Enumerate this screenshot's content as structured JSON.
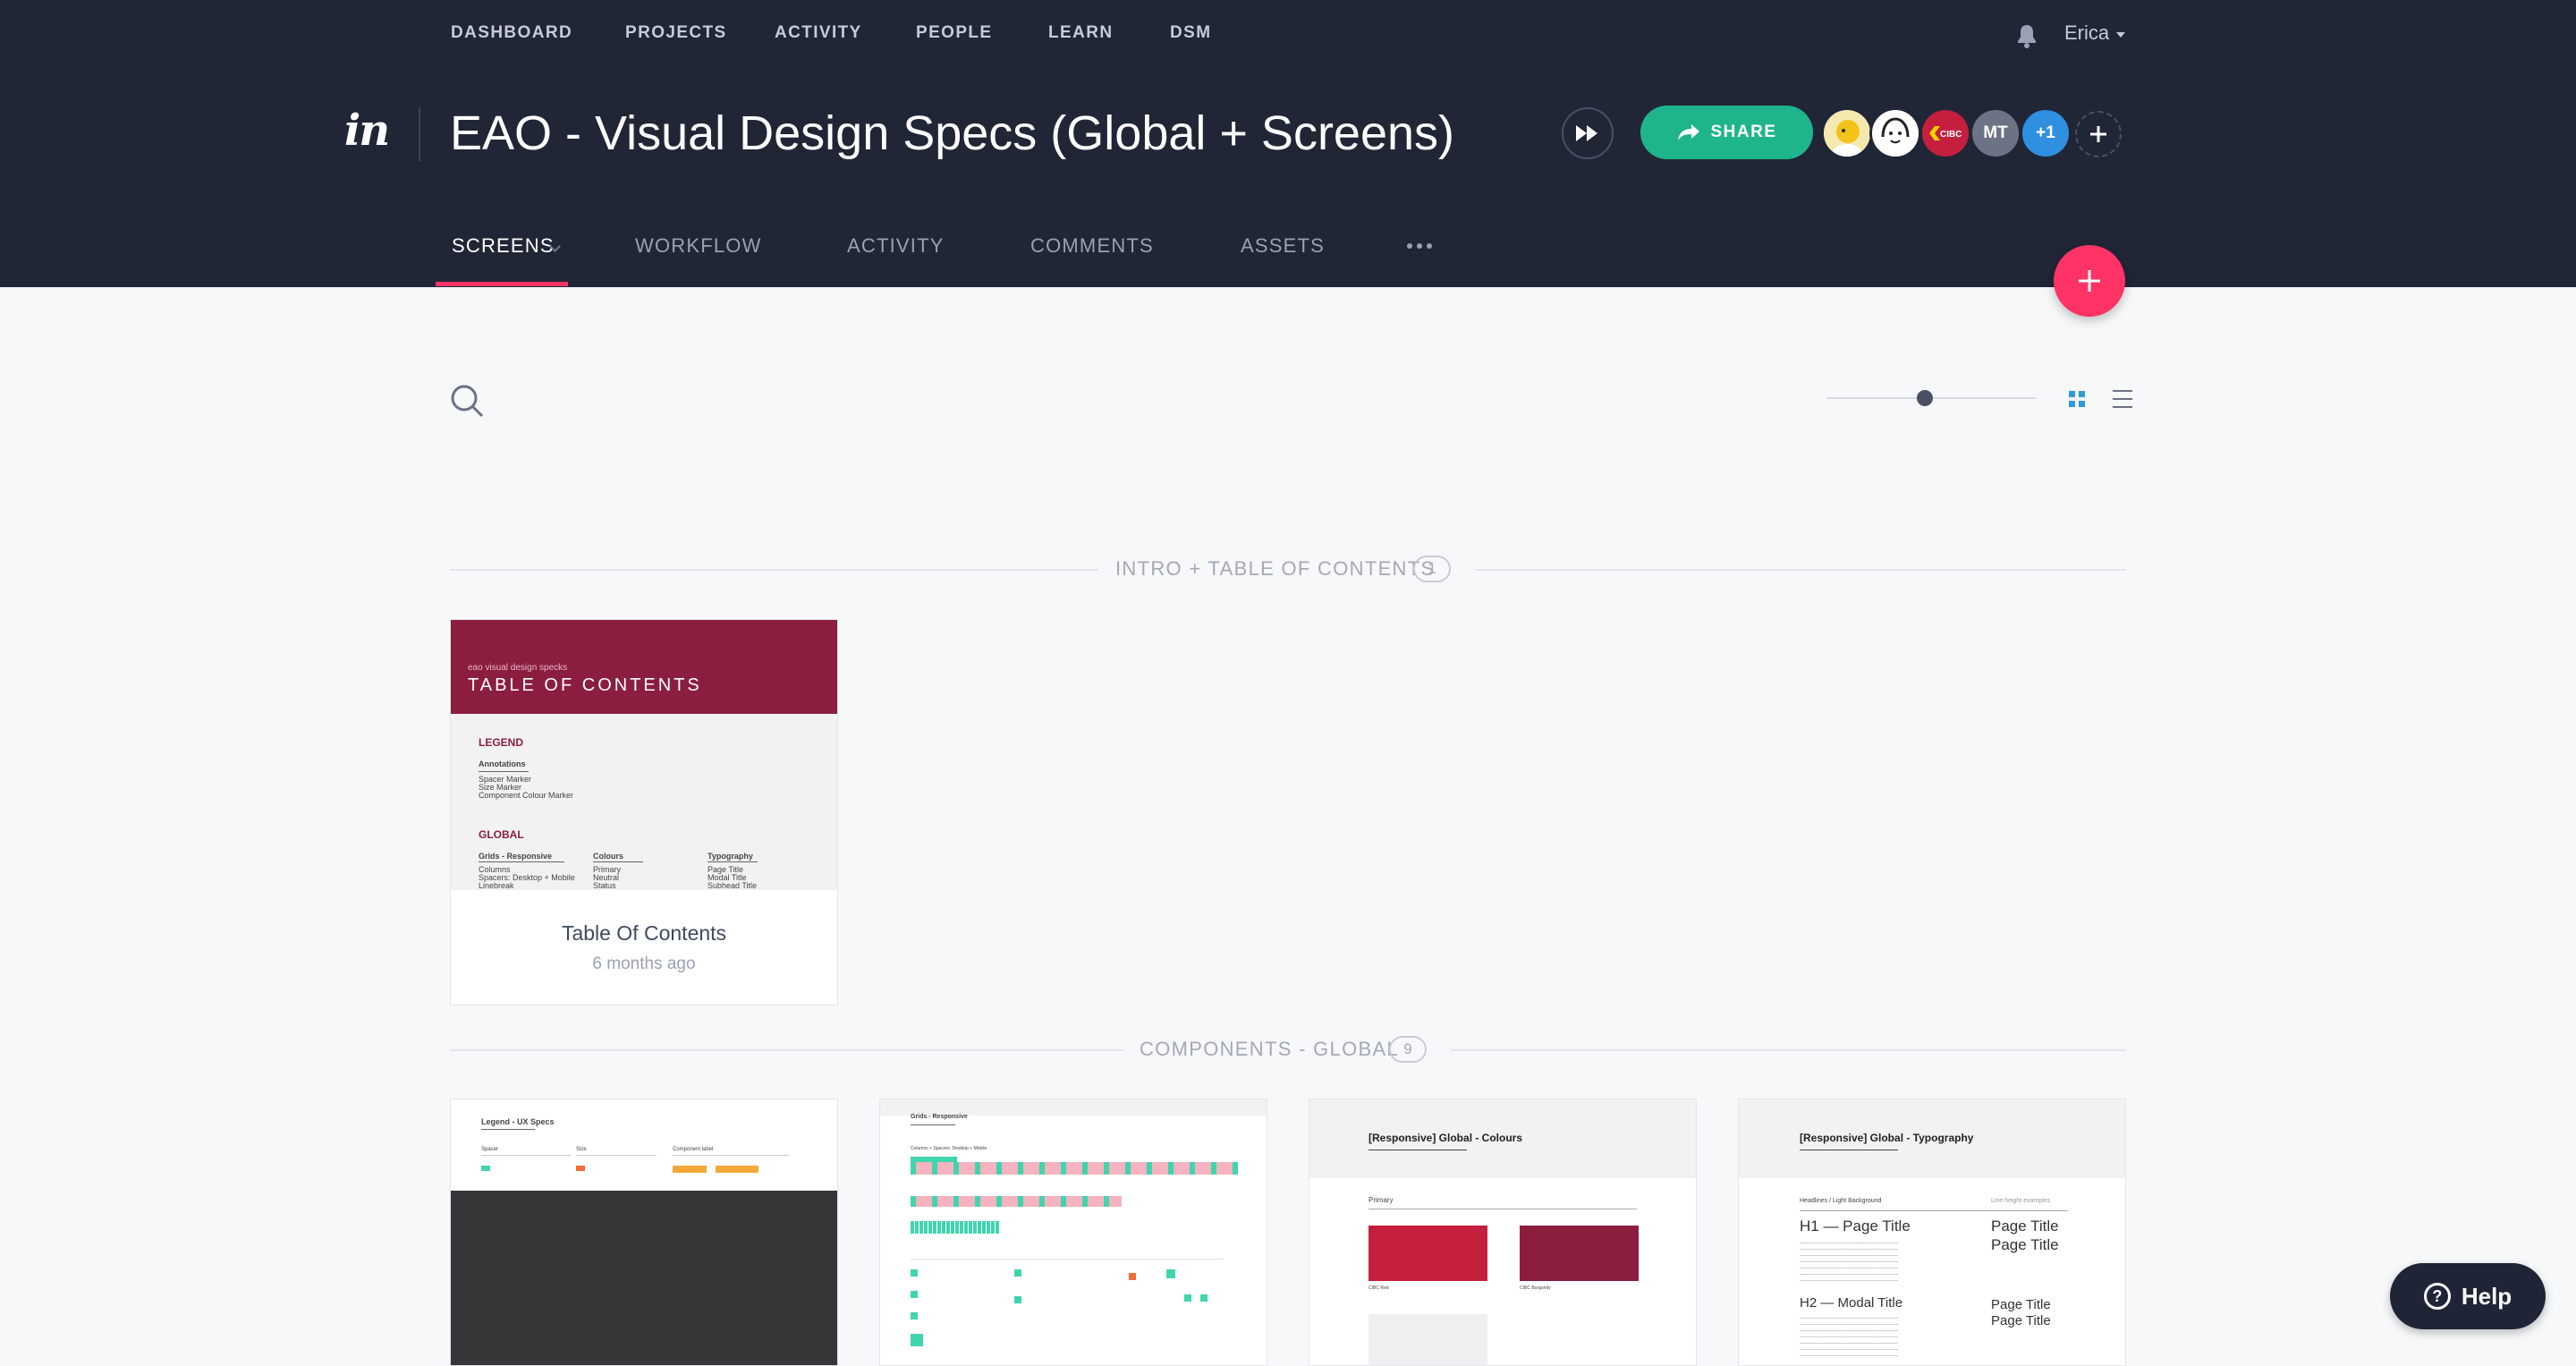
{
  "topnav": {
    "items": [
      {
        "label": "DASHBOARD"
      },
      {
        "label": "PROJECTS"
      },
      {
        "label": "ACTIVITY"
      },
      {
        "label": "PEOPLE"
      },
      {
        "label": "LEARN"
      },
      {
        "label": "DSM"
      }
    ],
    "user": "Erica"
  },
  "project": {
    "logo": "in",
    "title": "EAO - Visual Design Specs (Global + Screens)",
    "share_label": "SHARE",
    "collaborators": [
      "MT",
      "+1"
    ]
  },
  "subnav": {
    "tabs": [
      {
        "label": "SCREENS"
      },
      {
        "label": "WORKFLOW"
      },
      {
        "label": "ACTIVITY"
      },
      {
        "label": "COMMENTS"
      },
      {
        "label": "ASSETS"
      }
    ]
  },
  "toolbar": {
    "zoom_level": 0.47
  },
  "sections": [
    {
      "title": "INTRO + TABLE OF CONTENTS",
      "count": "1",
      "cards": [
        {
          "name": "Table Of Contents",
          "time": "6 months ago",
          "thumb": {
            "kicker": "eao visual design specks",
            "heading": "TABLE OF CONTENTS",
            "legend": "LEGEND",
            "annotations": "Annotations",
            "annotation_items": [
              "Spacer Marker",
              "Size Marker",
              "Component Colour Marker"
            ],
            "global": "GLOBAL",
            "columns": [
              {
                "head": "Grids - Responsive",
                "items": [
                  "Columns",
                  "Spacers: Desktop + Mobile",
                  "Linebreak"
                ]
              },
              {
                "head": "Colours",
                "items": [
                  "Primary",
                  "Neutral",
                  "Status"
                ]
              },
              {
                "head": "Typography",
                "items": [
                  "Page Title",
                  "Modal Title",
                  "Subhead Title"
                ]
              }
            ]
          }
        }
      ]
    },
    {
      "title": "COMPONENTS - GLOBAL",
      "count": "9",
      "cards": [
        {
          "thumb_title": "Legend - UX Specs",
          "headers": [
            "Spacer",
            "Size",
            "Component label"
          ]
        },
        {
          "thumb_title": "Grids - Responsive",
          "caption": "Columns + Spacers: Desktop + Mobile"
        },
        {
          "thumb_title": "[Responsive] Global - Colours",
          "sub": "Primary",
          "swatches": [
            "CIBC Red",
            "CIBC Burgundy"
          ]
        },
        {
          "thumb_title": "[Responsive] Global - Typography",
          "sub": "Headlines / Light Background",
          "note": "Line height examples",
          "h1": "H1 — Page Title",
          "h2": "H2 — Modal Title",
          "sample": "Page Title"
        }
      ]
    }
  ],
  "help_label": "Help",
  "colors": {
    "header_bg": "#212636",
    "accent_pink": "#ff3366",
    "share_green": "#1fb58c",
    "toc_burgundy": "#8b1e3f",
    "swatch_red": "#c41f3e",
    "swatch_burgundy": "#8b1e3f",
    "teal": "#3fd5ae",
    "pink_light": "#f4b3bf"
  }
}
